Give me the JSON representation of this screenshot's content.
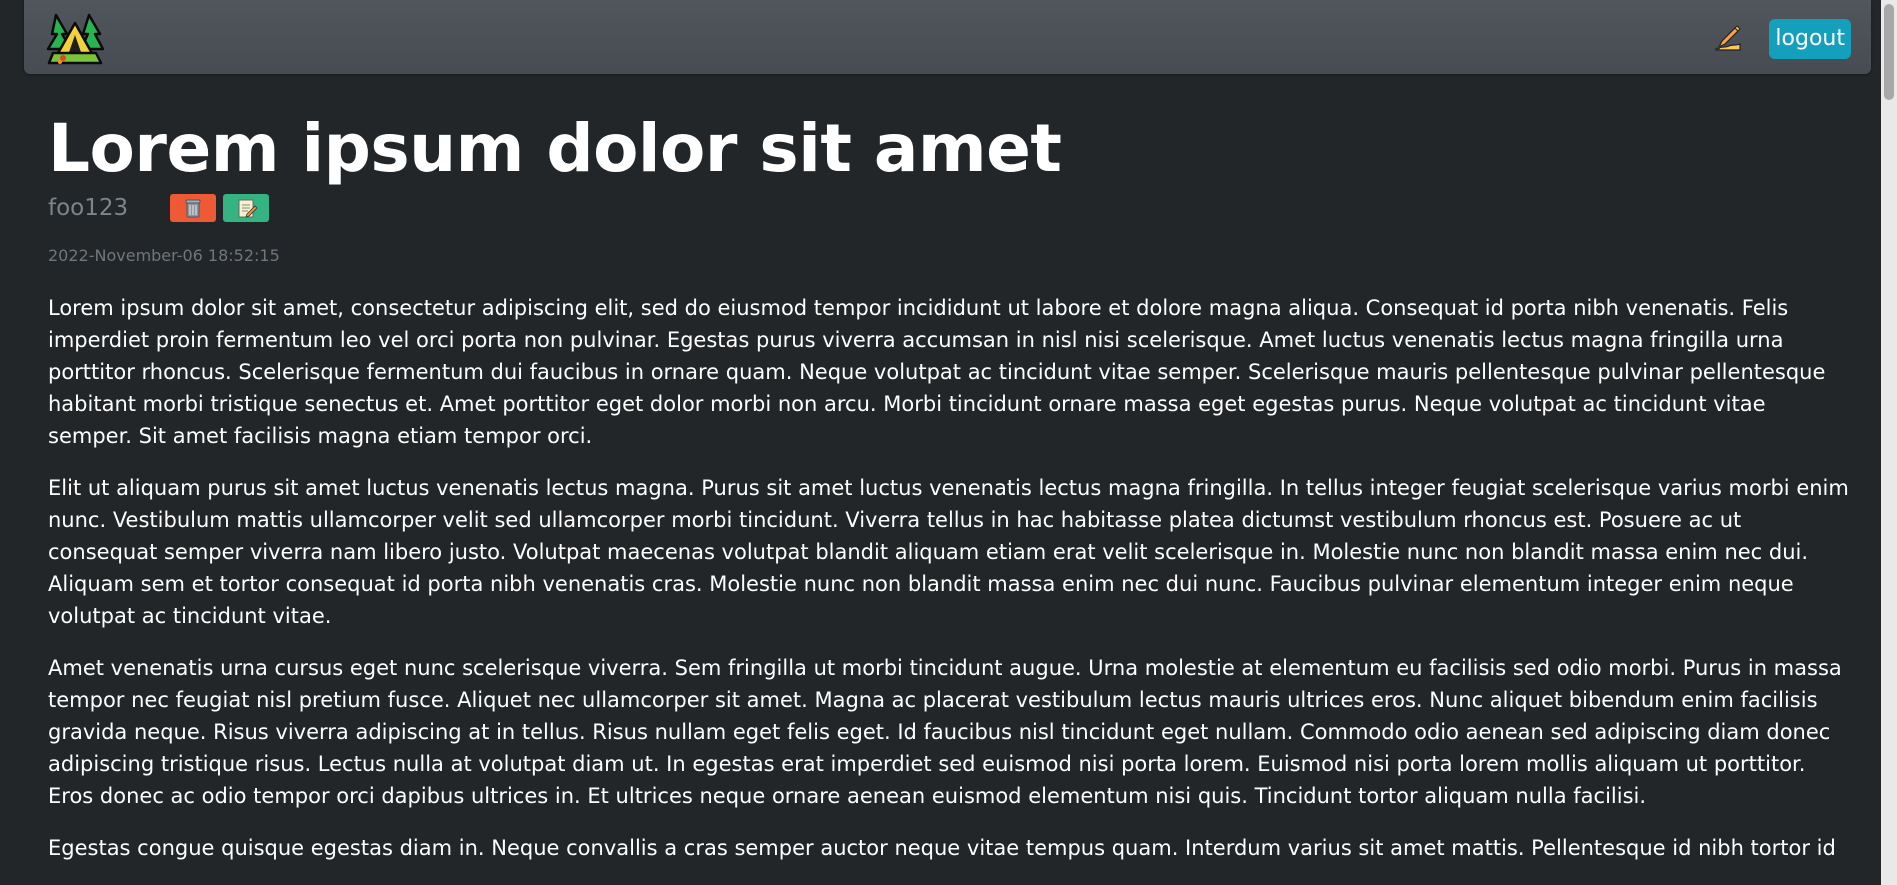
{
  "navbar": {
    "logo_icon": "camping-tent-trees-logo",
    "write_icon": "writing-hand-icon",
    "logout_label": "logout"
  },
  "post": {
    "title": "Lorem ipsum dolor sit amet",
    "author": "foo123",
    "delete_icon": "wastebasket-icon",
    "edit_icon": "memo-edit-icon",
    "timestamp": "2022-November-06 18:52:15",
    "paragraphs": [
      "Lorem ipsum dolor sit amet, consectetur adipiscing elit, sed do eiusmod tempor incididunt ut labore et dolore magna aliqua. Consequat id porta nibh venenatis. Felis imperdiet proin fermentum leo vel orci porta non pulvinar. Egestas purus viverra accumsan in nisl nisi scelerisque. Amet luctus venenatis lectus magna fringilla urna porttitor rhoncus. Scelerisque fermentum dui faucibus in ornare quam. Neque volutpat ac tincidunt vitae semper. Scelerisque mauris pellentesque pulvinar pellentesque habitant morbi tristique senectus et. Amet porttitor eget dolor morbi non arcu. Morbi tincidunt ornare massa eget egestas purus. Neque volutpat ac tincidunt vitae semper. Sit amet facilisis magna etiam tempor orci.",
      "Elit ut aliquam purus sit amet luctus venenatis lectus magna. Purus sit amet luctus venenatis lectus magna fringilla. In tellus integer feugiat scelerisque varius morbi enim nunc. Vestibulum mattis ullamcorper velit sed ullamcorper morbi tincidunt. Viverra tellus in hac habitasse platea dictumst vestibulum rhoncus est. Posuere ac ut consequat semper viverra nam libero justo. Volutpat maecenas volutpat blandit aliquam etiam erat velit scelerisque in. Molestie nunc non blandit massa enim nec dui. Aliquam sem et tortor consequat id porta nibh venenatis cras. Molestie nunc non blandit massa enim nec dui nunc. Faucibus pulvinar elementum integer enim neque volutpat ac tincidunt vitae.",
      "Amet venenatis urna cursus eget nunc scelerisque viverra. Sem fringilla ut morbi tincidunt augue. Urna molestie at elementum eu facilisis sed odio morbi. Purus in massa tempor nec feugiat nisl pretium fusce. Aliquet nec ullamcorper sit amet. Magna ac placerat vestibulum lectus mauris ultrices eros. Nunc aliquet bibendum enim facilisis gravida neque. Risus viverra adipiscing at in tellus. Risus nullam eget felis eget. Id faucibus nisl tincidunt eget nullam. Commodo odio aenean sed adipiscing diam donec adipiscing tristique risus. Lectus nulla at volutpat diam ut. In egestas erat imperdiet sed euismod nisi porta lorem. Euismod nisi porta lorem mollis aliquam ut porttitor. Eros donec ac odio tempor orci dapibus ultrices in. Et ultrices neque ornare aenean euismod elementum nisi quis. Tincidunt tortor aliquam nulla facilisi.",
      "Egestas congue quisque egestas diam in. Neque convallis a cras semper auctor neque vitae tempus quam. Interdum varius sit amet mattis. Pellentesque id nibh tortor id"
    ]
  },
  "colors": {
    "page_background": "#222629",
    "navbar_background": "#4b5056",
    "logout_button": "#14a0bd",
    "delete_button": "#ee5a36",
    "edit_button": "#33b482",
    "muted_text": "#7d848a"
  }
}
